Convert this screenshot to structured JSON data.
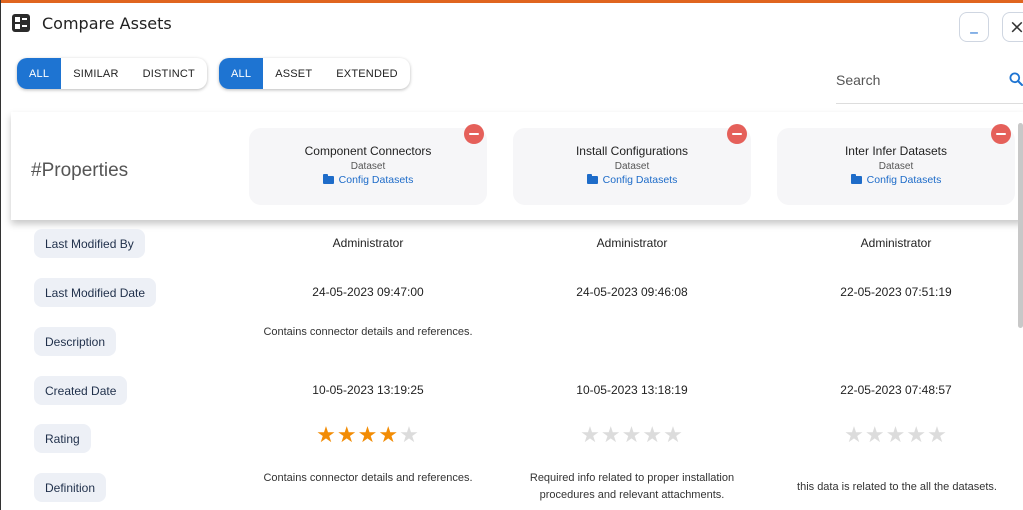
{
  "window": {
    "title": "Compare Assets",
    "minimize_label": "_",
    "close_label": "×"
  },
  "filters": {
    "match": [
      {
        "label": "ALL",
        "active": true
      },
      {
        "label": "SIMILAR",
        "active": false
      },
      {
        "label": "DISTINCT",
        "active": false
      }
    ],
    "scope": [
      {
        "label": "ALL",
        "active": true
      },
      {
        "label": "ASSET",
        "active": false
      },
      {
        "label": "EXTENDED",
        "active": false
      }
    ]
  },
  "search": {
    "placeholder": "Search",
    "icon": "search-icon"
  },
  "properties_heading": "#Properties",
  "assets": [
    {
      "name": "Component Connectors",
      "type": "Dataset",
      "folder": "Config Datasets"
    },
    {
      "name": "Install Configurations",
      "type": "Dataset",
      "folder": "Config Datasets"
    },
    {
      "name": "Inter Infer Datasets",
      "type": "Dataset",
      "folder": "Config Datasets"
    }
  ],
  "rows": [
    {
      "label": "Last Modified By",
      "values": [
        "Administrator",
        "Administrator",
        "Administrator"
      ]
    },
    {
      "label": "Last Modified Date",
      "values": [
        "24-05-2023 09:47:00",
        "24-05-2023 09:46:08",
        "22-05-2023 07:51:19"
      ]
    },
    {
      "label": "Description",
      "values": [
        "Contains connector details and references.",
        "",
        ""
      ]
    },
    {
      "label": "Created Date",
      "values": [
        "10-05-2023 13:19:25",
        "10-05-2023 13:18:19",
        "22-05-2023 07:48:57"
      ]
    },
    {
      "label": "Rating",
      "ratings": [
        4,
        0,
        0
      ],
      "max": 5
    },
    {
      "label": "Definition",
      "values": [
        "Contains connector details and references.",
        "Required info related to proper installation procedures and relevant attachments.",
        "this data is related to the all the datasets."
      ]
    }
  ],
  "colors": {
    "accent": "#1e74d2",
    "remove": "#e5605a",
    "star_on": "#f28c05",
    "star_off": "#dcdcdc",
    "top_border": "#e0651f"
  }
}
